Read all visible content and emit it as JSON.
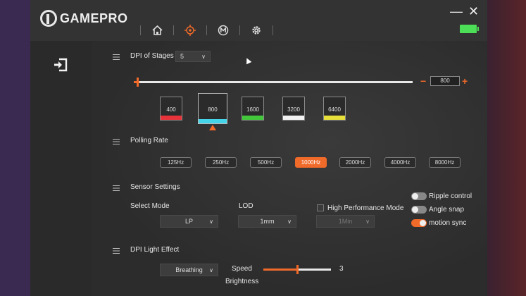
{
  "header": {
    "brand": "GAMEPRO",
    "nav": [
      {
        "icon": "home-icon"
      },
      {
        "icon": "dpi-crosshair-icon",
        "active": true
      },
      {
        "icon": "macro-m-icon"
      },
      {
        "icon": "settings-gear-icon"
      }
    ],
    "minimize": "—",
    "close": "✕",
    "battery_color": "#4cde57"
  },
  "sidebar": {
    "exit_icon": "exit-icon"
  },
  "dpi": {
    "label": "DPI of Stages",
    "stages_count": "5",
    "value": "800",
    "minus": "−",
    "plus": "+",
    "slider_level": 0.01,
    "stages": [
      {
        "value": "400",
        "color": "#e8333a"
      },
      {
        "value": "800",
        "color": "#44d6e8",
        "selected": true
      },
      {
        "value": "1600",
        "color": "#42c83a"
      },
      {
        "value": "3200",
        "color": "#f2f2f2"
      },
      {
        "value": "6400",
        "color": "#e8e03a"
      }
    ]
  },
  "polling": {
    "label": "Polling Rate",
    "rates": [
      "125Hz",
      "250Hz",
      "500Hz",
      "1000Hz",
      "2000Hz",
      "4000Hz",
      "8000Hz"
    ],
    "active_index": 3
  },
  "sensor": {
    "label": "Sensor Settings",
    "select_mode_label": "Select Mode",
    "select_mode_value": "LP",
    "lod_label": "LOD",
    "lod_value": "1mm",
    "high_perf_label": "High Performance Mode",
    "high_perf_value": "1Min",
    "toggles": [
      {
        "label": "Ripple control",
        "on": false
      },
      {
        "label": "Angle snap",
        "on": false
      },
      {
        "label": "motion sync",
        "on": true
      }
    ]
  },
  "light": {
    "label": "DPI Light Effect",
    "effect_value": "Breathing",
    "speed_label": "Speed",
    "speed_value": "3",
    "speed_level": 0.5,
    "brightness_label": "Brightness"
  },
  "colors": {
    "accent": "#f06a2a"
  }
}
